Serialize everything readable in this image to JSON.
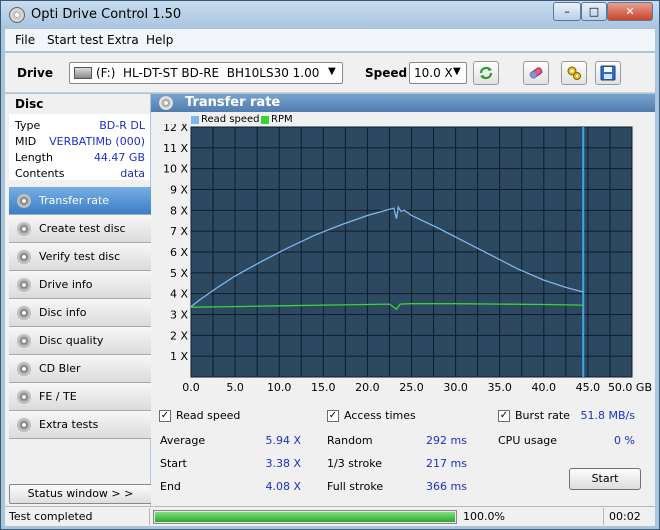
{
  "window": {
    "title": "Opti Drive Control 1.50",
    "min": "–",
    "max": "□",
    "close": "✕"
  },
  "menu": [
    "File",
    "Start test",
    "Extra",
    "Help"
  ],
  "toolbar": {
    "drive_label": "Drive",
    "drive_value": "(F:)  HL-DT-ST BD-RE  BH10LS30 1.00",
    "speed_label": "Speed",
    "speed_value": "10.0 X",
    "arrow": "▼"
  },
  "disc": {
    "header": "Disc",
    "rows": [
      {
        "key": "Type",
        "value": "BD-R DL"
      },
      {
        "key": "MID",
        "value": "VERBATIMb (000)"
      },
      {
        "key": "Length",
        "value": "44.47 GB"
      },
      {
        "key": "Contents",
        "value": "data"
      }
    ]
  },
  "nav": [
    {
      "label": "Transfer rate",
      "active": true
    },
    {
      "label": "Create test disc",
      "active": false
    },
    {
      "label": "Verify test disc",
      "active": false
    },
    {
      "label": "Drive info",
      "active": false
    },
    {
      "label": "Disc info",
      "active": false
    },
    {
      "label": "Disc quality",
      "active": false
    },
    {
      "label": "CD Bler",
      "active": false
    },
    {
      "label": "FE / TE",
      "active": false
    },
    {
      "label": "Extra tests",
      "active": false
    }
  ],
  "status_window_label": "Status window > >",
  "panel_title": "Transfer rate",
  "chart_data": {
    "type": "line",
    "legend": [
      {
        "name": "Read speed",
        "color": "#7fb6ea"
      },
      {
        "name": "RPM",
        "color": "#3ad23a"
      }
    ],
    "x_ticks": [
      "0.0",
      "5.0",
      "10.0",
      "15.0",
      "20.0",
      "25.0",
      "30.0",
      "35.0",
      "40.0",
      "45.0",
      "50.0 GB"
    ],
    "y_ticks": [
      "1 X",
      "2 X",
      "3 X",
      "4 X",
      "5 X",
      "6 X",
      "7 X",
      "8 X",
      "9 X",
      "10 X",
      "11 X",
      "12 X"
    ],
    "xlim": [
      0,
      50
    ],
    "ylim": [
      0,
      12
    ],
    "marker_x": 44.47,
    "series": [
      {
        "name": "Read speed",
        "x": [
          0.0,
          1.0,
          3.0,
          5.0,
          8.0,
          11.0,
          14.0,
          17.0,
          20.0,
          22.5,
          23.0,
          23.3,
          23.5,
          23.8,
          24.2,
          25.0,
          28.0,
          31.0,
          34.0,
          37.0,
          40.0,
          42.5,
          44.47
        ],
        "y": [
          3.38,
          3.7,
          4.3,
          4.85,
          5.55,
          6.2,
          6.8,
          7.3,
          7.75,
          8.05,
          8.1,
          7.6,
          8.15,
          7.95,
          8.0,
          7.75,
          7.15,
          6.5,
          5.85,
          5.2,
          4.65,
          4.3,
          4.08
        ]
      },
      {
        "name": "RPM",
        "x": [
          0.0,
          5.0,
          10.0,
          15.0,
          20.0,
          22.5,
          23.3,
          23.7,
          25.0,
          30.0,
          35.0,
          40.0,
          44.47
        ],
        "y": [
          3.35,
          3.38,
          3.42,
          3.45,
          3.48,
          3.5,
          3.25,
          3.5,
          3.52,
          3.52,
          3.5,
          3.48,
          3.45
        ]
      }
    ]
  },
  "stats": {
    "read_speed": "Read speed",
    "access_times": "Access times",
    "burst_rate": "Burst rate",
    "burst_value": "51.8 MB/s",
    "check": "✓",
    "average_label": "Average",
    "average_value": "5.94 X",
    "start_label": "Start",
    "start_value": "3.38 X",
    "end_label": "End",
    "end_value": "4.08 X",
    "random_label": "Random",
    "random_value": "292 ms",
    "third_label": "1/3 stroke",
    "third_value": "217 ms",
    "full_label": "Full stroke",
    "full_value": "366 ms",
    "cpu_label": "CPU usage",
    "cpu_value": "0 %",
    "start_button": "Start"
  },
  "statusbar": {
    "text": "Test completed",
    "progress": 1.0,
    "percent": "100.0%",
    "time": "00:02"
  }
}
